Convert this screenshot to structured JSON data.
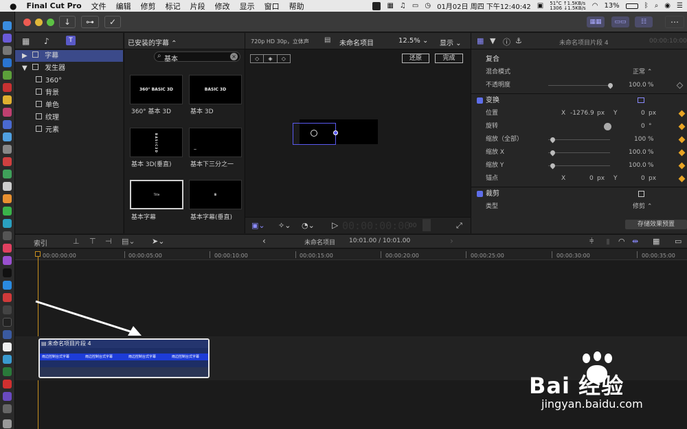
{
  "menubar": {
    "app": "Final Cut Pro",
    "items": [
      "文件",
      "编辑",
      "修剪",
      "标记",
      "片段",
      "修改",
      "显示",
      "窗口",
      "帮助"
    ],
    "cpu_temp": "51°C",
    "cpu_fan": "1306",
    "net_up": "↑1.5KB/s",
    "net_down": "↓1.5KB/s",
    "battery": "13%",
    "datetime": "01月02日 周四 下午12:40:42"
  },
  "library": {
    "dropdown": "已安装的字幕 ⌃",
    "tree": [
      {
        "label": "字幕",
        "level": 0,
        "selected": true
      },
      {
        "label": "发生器",
        "level": 0
      },
      {
        "label": "360°",
        "level": 1
      },
      {
        "label": "背景",
        "level": 1
      },
      {
        "label": "单色",
        "level": 1
      },
      {
        "label": "纹理",
        "level": 1
      },
      {
        "label": "元素",
        "level": 1
      }
    ],
    "search_value": "基本"
  },
  "browser": {
    "items": [
      {
        "thumb": "360° BASIC 3D",
        "caption": "360° 基本 3D"
      },
      {
        "thumb": "BASIC 3D",
        "caption": "基本 3D"
      },
      {
        "thumb": "B A S I C 3 D",
        "caption": "基本 3D(垂直)"
      },
      {
        "thumb": "—",
        "caption": "基本下三分之一"
      },
      {
        "thumb": "Title",
        "caption": "基本字幕"
      },
      {
        "thumb": "B",
        "caption": "基本字幕(垂直)"
      }
    ]
  },
  "viewer": {
    "format": "720p HD 30p，立体声",
    "project": "未命名项目",
    "zoom": "12.5% ⌄",
    "display": "显示 ⌄",
    "revert_btn": "还原",
    "done_btn": "完成",
    "timecode": "00:00:00:00",
    "timecode_frac": "00"
  },
  "inspector": {
    "title": "未命名项目片段 4",
    "timecode": "00:00:10:00",
    "composite": "复合",
    "blend_mode_label": "混合模式",
    "blend_mode_value": "正常 ⌃",
    "opacity_label": "不透明度",
    "opacity_value": "100.0",
    "opacity_unit": "%",
    "opacity_level": 1.0,
    "transform": "变换",
    "position_label": "位置",
    "x_label": "X",
    "position_x": "-1276.9",
    "px": "px",
    "y_label": "Y",
    "position_y": "0",
    "rotation_label": "旋转",
    "rotation_value": "0",
    "degree": "°",
    "scale_all_label": "缩放（全部）",
    "scale_all_value": "100",
    "scale_x_label": "缩放 X",
    "scale_x_value": "100.0",
    "scale_y_label": "缩放 Y",
    "scale_y_value": "100.0",
    "anchor_label": "锚点",
    "anchor_x": "0",
    "anchor_y": "0",
    "crop": "裁剪",
    "crop_type_label": "类型",
    "crop_type_value": "修剪 ⌃",
    "save_preset": "存储效果预置"
  },
  "timeline": {
    "index": "索引",
    "project": "未命名项目",
    "duration": "10:01.00 / 10:01.00",
    "ruler": [
      "00:00:00:00",
      "00:00:05:00",
      "00:00:10:00",
      "00:00:15:00",
      "00:00:20:00",
      "00:00:25:00",
      "00:00:30:00",
      "00:00:35:00"
    ],
    "clip_title": "未命名项目片段 4",
    "clip_seg_text": "雨边控制台式字幕"
  },
  "watermark": {
    "brand": "Bai 经验",
    "url": "jingyan.baidu.com"
  }
}
